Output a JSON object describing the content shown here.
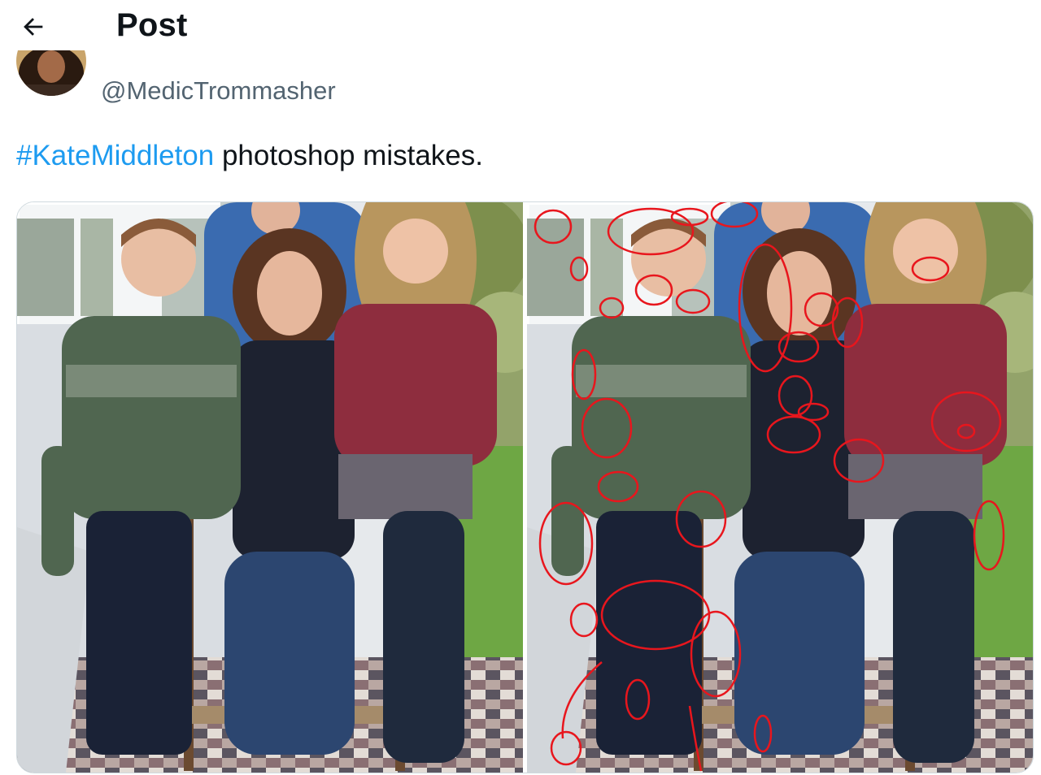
{
  "header": {
    "back_icon": "arrow-left-icon",
    "title": "Post"
  },
  "user": {
    "handle": "@MedicTrommasher",
    "avatar_icon": "user-avatar"
  },
  "tweet": {
    "hashtag": "#KateMiddleton",
    "text": " photoshop mistakes."
  },
  "media": {
    "images": [
      {
        "name": "original-family-photo"
      },
      {
        "name": "annotated-family-photo",
        "annotation_color": "#e8161d"
      }
    ]
  },
  "colors": {
    "link": "#1d9bf0",
    "secondary_text": "#536471",
    "primary_text": "#0f1419"
  }
}
